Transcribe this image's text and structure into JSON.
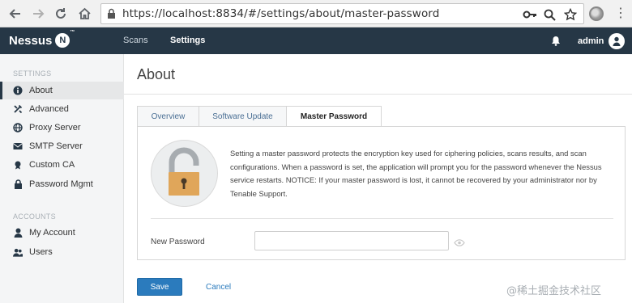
{
  "browser": {
    "url": "https://localhost:8834/#/settings/about/master-password"
  },
  "app": {
    "logo_text": "Nessus",
    "logo_badge": "N",
    "logo_tm": "™",
    "nav": [
      "Scans",
      "Settings"
    ],
    "active_nav": "Settings",
    "user": "admin"
  },
  "sidebar": {
    "settings_title": "SETTINGS",
    "settings_items": [
      {
        "label": "About",
        "icon": "info-icon",
        "active": true
      },
      {
        "label": "Advanced",
        "icon": "tools-icon"
      },
      {
        "label": "Proxy Server",
        "icon": "globe-icon"
      },
      {
        "label": "SMTP Server",
        "icon": "envelope-icon"
      },
      {
        "label": "Custom CA",
        "icon": "certificate-icon"
      },
      {
        "label": "Password Mgmt",
        "icon": "lock-icon"
      }
    ],
    "accounts_title": "ACCOUNTS",
    "accounts_items": [
      {
        "label": "My Account",
        "icon": "user-icon"
      },
      {
        "label": "Users",
        "icon": "users-icon"
      }
    ]
  },
  "main": {
    "title": "About",
    "tabs": [
      {
        "label": "Overview"
      },
      {
        "label": "Software Update"
      },
      {
        "label": "Master Password",
        "active": true
      }
    ],
    "description": "Setting a master password protects the encryption key used for ciphering policies, scans results, and scan configurations. When a password is set, the application will prompt you for the password whenever the Nessus service restarts. NOTICE: If your master password is lost, it cannot be recovered by your administrator nor by Tenable Support.",
    "new_password_label": "New Password",
    "new_password_value": "",
    "save_label": "Save",
    "cancel_label": "Cancel"
  },
  "watermark": "@稀土掘金技术社区",
  "colors": {
    "header_bg": "#263746",
    "accent_blue": "#2b7bbd",
    "lock_body": "#e0a65a"
  }
}
